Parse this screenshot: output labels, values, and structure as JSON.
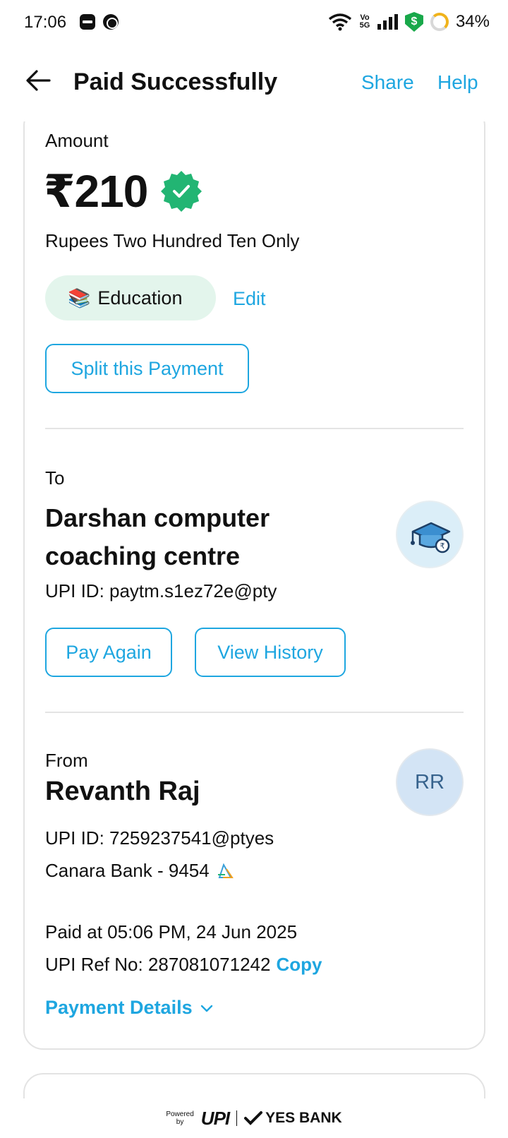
{
  "status_bar": {
    "time": "17:06",
    "volte_top": "Vo",
    "volte_bottom": "5G",
    "shield_symbol": "$",
    "battery": "34%"
  },
  "header": {
    "title": "Paid Successfully",
    "share": "Share",
    "help": "Help"
  },
  "amount": {
    "label": "Amount",
    "value": "₹210",
    "words": "Rupees Two Hundred Ten Only",
    "category_icon": "📚",
    "category": "Education",
    "edit": "Edit",
    "split_button": "Split this Payment"
  },
  "to": {
    "label": "To",
    "name": "Darshan computer coaching centre",
    "upi": "UPI ID: paytm.s1ez72e@pty",
    "pay_again": "Pay Again",
    "view_history": "View History"
  },
  "from": {
    "label": "From",
    "name": "Revanth Raj",
    "initials": "RR",
    "upi": "UPI ID: 7259237541@ptyes",
    "bank": "Canara Bank - 9454"
  },
  "details": {
    "paid_at": "Paid at 05:06 PM, 24 Jun 2025",
    "ref_no": "UPI Ref No: 287081071242",
    "copy": "Copy",
    "payment_details": "Payment Details"
  },
  "footer": {
    "powered_line1": "Powered",
    "powered_line2": "by",
    "upi": "UPI",
    "bank": "YES BANK"
  },
  "colors": {
    "accent": "#1ea6e0",
    "verified_green": "#22b573",
    "chip_bg": "#e3f5ec"
  }
}
